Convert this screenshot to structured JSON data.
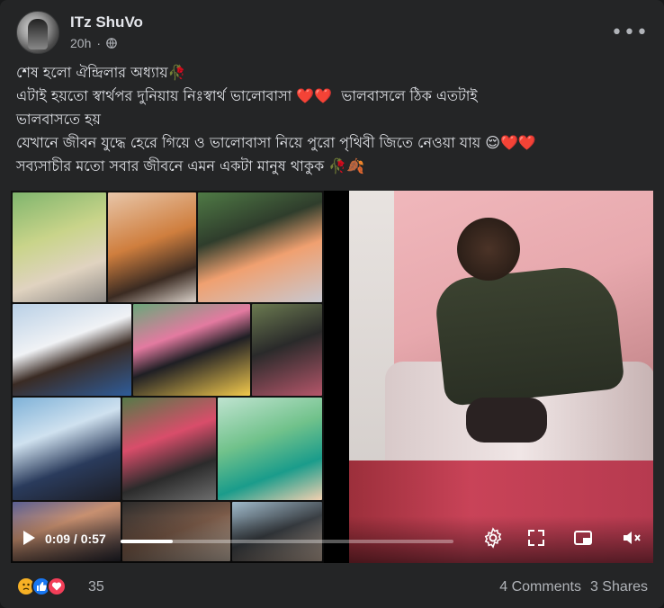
{
  "post": {
    "author_name": "ITz ShuVo",
    "time_ago": "20h",
    "privacy_icon": "globe-icon",
    "more_icon": "more-dots-icon",
    "text_line1": "শেষ হলো ঐন্দ্রিলার অধ্যায়🥀",
    "text_line2": "এটাই হয়তো স্বার্থপর দুনিয়ায় নিঃস্বার্থ ভালোবাসা ❤️❤️  ভালবাসলে ঠিক এতটাই",
    "text_line3": "ভালবাসতে হয়",
    "text_line4": "যেখানে জীবন যুদ্ধে হেরে গিয়ে ও ভালোবাসা নিয়ে পুরো পৃথিবী জিতে নেওয়া যায় 😌❤️❤️",
    "text_line5": "সব্যসাচীর মতো সবার জীবনে এমন একটা মানুষ থাকুক 🥀🍂"
  },
  "video": {
    "current_time": "0:09",
    "separator": "/",
    "duration": "0:57",
    "progress_fraction": 0.158,
    "icons": [
      "play-icon",
      "settings-icon",
      "fullscreen-icon",
      "picture-in-picture-icon",
      "mute-icon"
    ]
  },
  "footer": {
    "reaction_icons": [
      "sad-reaction-icon",
      "like-reaction-icon",
      "love-reaction-icon"
    ],
    "reaction_count": "35",
    "comments": "4 Comments",
    "shares": "3 Shares"
  },
  "colors": {
    "card_bg": "#242526",
    "text_primary": "#e4e6eb",
    "text_secondary": "#b0b3b8",
    "like_blue": "#1877f2",
    "love_red": "#f33e58",
    "sad_yellow": "#f7b125"
  }
}
